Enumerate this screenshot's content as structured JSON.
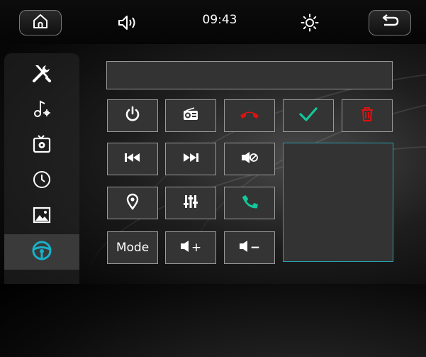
{
  "status_bar": {
    "time": "09:43",
    "icons": [
      "home-icon",
      "volume-icon",
      "brightness-icon",
      "back-icon"
    ]
  },
  "sidebar": {
    "items": [
      {
        "icon": "tools-icon",
        "active": false
      },
      {
        "icon": "music-settings-icon",
        "active": false
      },
      {
        "icon": "tv-settings-icon",
        "active": false
      },
      {
        "icon": "clock-icon",
        "active": false
      },
      {
        "icon": "picture-icon",
        "active": false
      },
      {
        "icon": "steering-wheel-icon",
        "active": true
      }
    ]
  },
  "keys": {
    "mode_label": "Mode",
    "vol_up_label": "+",
    "vol_down_label": "−"
  },
  "colors": {
    "accent": "#18b0c8",
    "call_hangup": "#e21010",
    "call_answer": "#12c89a",
    "confirm": "#12c89a",
    "delete": "#e21010"
  }
}
